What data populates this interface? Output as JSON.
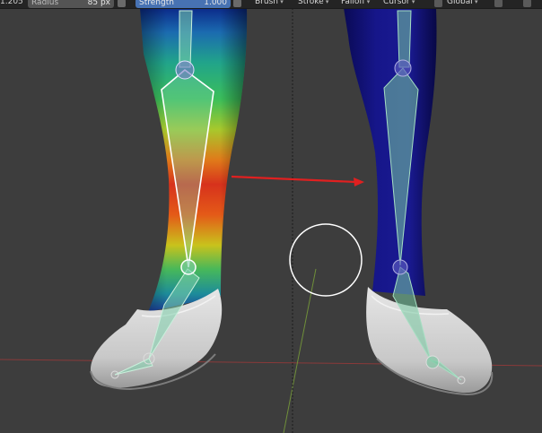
{
  "header": {
    "left_value": "1.205",
    "radius": {
      "label": "Radius",
      "value": "85 px"
    },
    "strength": {
      "label": "Strength",
      "value": "1.000"
    },
    "menus": [
      "Brush",
      "Stroke",
      "Falloff",
      "Cursor"
    ],
    "orientation": "Global"
  },
  "colors": {
    "viewport_bg": "#3d3d3d",
    "header_bg": "#242424",
    "field_bg": "#545454",
    "strength_field_bg": "#4772b3",
    "weight_zero_blue": "#13137e",
    "arrow_red": "#e02020",
    "bone_green": "#76c8a0",
    "brush_circle": "#ffffff"
  },
  "icons": [
    "pressure-icon",
    "cursor-icon",
    "gizmo-icon",
    "snap-icon"
  ]
}
